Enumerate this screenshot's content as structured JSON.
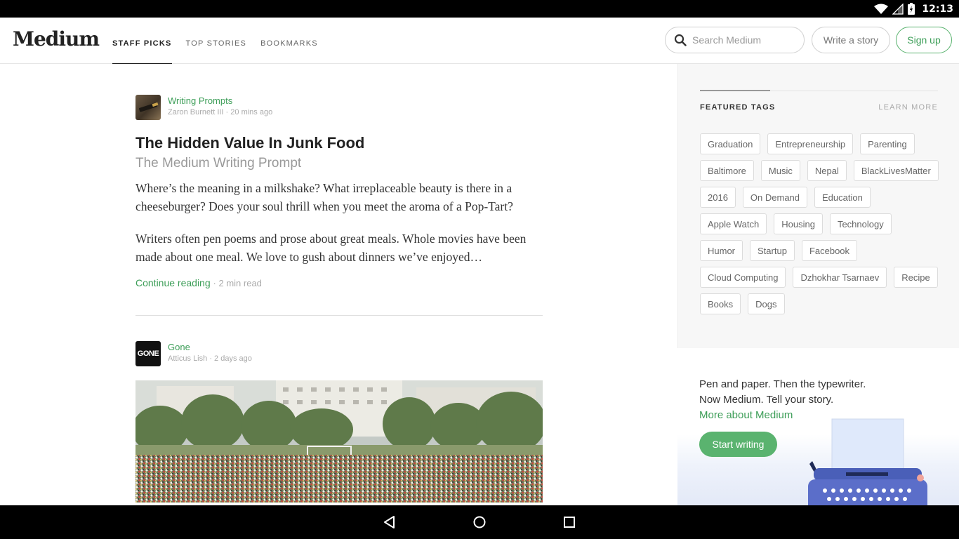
{
  "status_bar": {
    "time": "12:13"
  },
  "header": {
    "logo": "Medium",
    "tabs": [
      {
        "label": "STAFF PICKS",
        "active": true
      },
      {
        "label": "TOP STORIES",
        "active": false
      },
      {
        "label": "BOOKMARKS",
        "active": false
      }
    ],
    "search_placeholder": "Search Medium",
    "write_label": "Write a story",
    "signup_label": "Sign up"
  },
  "posts": [
    {
      "publication": "Writing Prompts",
      "author": "Zaron Burnett III",
      "time": "20 mins ago",
      "title": "The Hidden Value In Junk Food",
      "subtitle": "The Medium Writing Prompt",
      "paragraphs": [
        "Where’s the meaning in a milkshake? What irreplaceable beauty is there in a cheeseburger? Does your soul thrill when you meet the aroma of a Pop-Tart?",
        "Writers often pen poems and prose about great meals. Whole movies have been made about one meal. We love to gush about dinners we’ve enjoyed…"
      ],
      "continue_label": "Continue reading",
      "read_time": "2 min read"
    },
    {
      "publication": "Gone",
      "avatar_text": "GONE",
      "author": "Atticus Lish",
      "time": "2 days ago"
    }
  ],
  "sidebar": {
    "featured_title": "FEATURED TAGS",
    "learn_more": "LEARN MORE",
    "tags": [
      "Graduation",
      "Entrepreneurship",
      "Parenting",
      "Baltimore",
      "Music",
      "Nepal",
      "BlackLivesMatter",
      "2016",
      "On Demand",
      "Education",
      "Apple Watch",
      "Housing",
      "Technology",
      "Humor",
      "Startup",
      "Facebook",
      "Cloud Computing",
      "Dzhokhar Tsarnaev",
      "Recipe",
      "Books",
      "Dogs"
    ]
  },
  "promo": {
    "line1": "Pen and paper. Then the typewriter.",
    "line2": "Now Medium. Tell your story.",
    "link": "More about Medium",
    "button": "Start writing"
  },
  "colors": {
    "accent": "#3d9e58",
    "button_green": "#5ab36f",
    "typewriter": "#5b6ec9"
  }
}
